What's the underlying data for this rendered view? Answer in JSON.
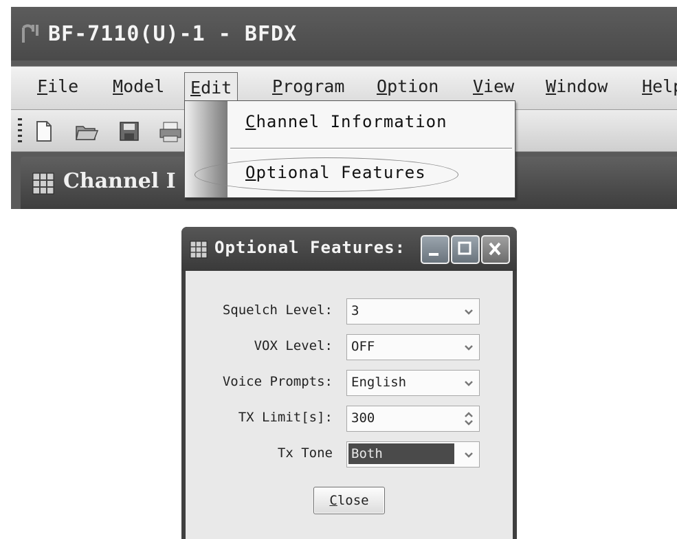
{
  "app": {
    "title": "BF-7110(U)-1 - BFDX",
    "menu": [
      {
        "label": "File",
        "underline": "F",
        "rest": "ile"
      },
      {
        "label": "Model",
        "underline": "M",
        "rest": "odel"
      },
      {
        "label": "Edit",
        "underline": "E",
        "rest": "dit"
      },
      {
        "label": "Program",
        "underline": "P",
        "rest": "rogram"
      },
      {
        "label": "Option",
        "underline": "O",
        "rest": "ption"
      },
      {
        "label": "View",
        "underline": "V",
        "rest": "iew"
      },
      {
        "label": "Window",
        "underline": "W",
        "rest": "indow"
      },
      {
        "label": "Help",
        "underline": "H",
        "rest": "elp"
      }
    ],
    "toolbar_icons": [
      "new-file-icon",
      "open-folder-icon",
      "save-icon",
      "print-icon"
    ],
    "document_title": "Channel I"
  },
  "edit_menu": {
    "items": [
      {
        "label": "Channel Information",
        "underline": "C",
        "rest": "hannel Information"
      },
      {
        "label": "Optional Features",
        "underline": "O",
        "rest": "ptional Features"
      }
    ]
  },
  "dialog": {
    "title": "Optional Features:",
    "fields": [
      {
        "label": "Squelch Level:",
        "value": "3",
        "control": "dropdown"
      },
      {
        "label": "VOX Level:",
        "value": "OFF",
        "control": "dropdown"
      },
      {
        "label": "Voice Prompts:",
        "value": "English",
        "control": "dropdown"
      },
      {
        "label": "TX Limit[s]:",
        "value": "300",
        "control": "spinbox"
      },
      {
        "label": "Tx Tone",
        "value": "Both",
        "control": "dropdown"
      }
    ],
    "close_button": {
      "label": "Close",
      "underline": "C",
      "rest": "lose"
    }
  }
}
